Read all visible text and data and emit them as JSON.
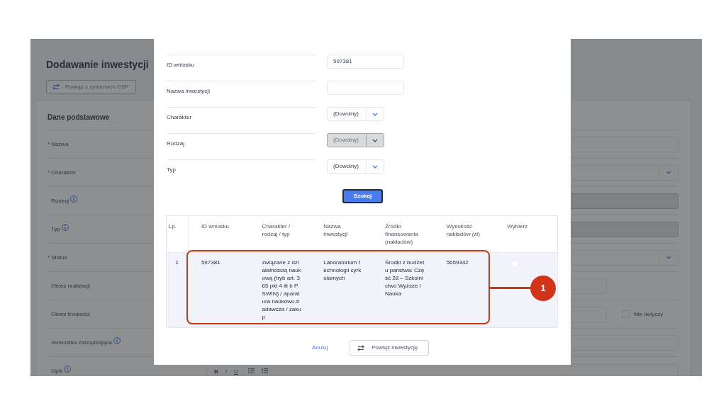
{
  "page": {
    "title": "Dodawanie inwestycji",
    "link_button": "Powiąż z systemem OSF",
    "section_title": "Dane podstawowe",
    "fields": [
      {
        "marker": "*",
        "label": "Nazwa",
        "info": false,
        "kind": "input"
      },
      {
        "marker": "*",
        "label": "Charakter",
        "info": false,
        "kind": "select"
      },
      {
        "label": "Rodzaj",
        "info": true,
        "kind": "disabled"
      },
      {
        "label": "Typ",
        "info": true,
        "kind": "disabled"
      },
      {
        "marker": "*",
        "label": "Status",
        "info": false,
        "kind": "select"
      },
      {
        "label": "Okres realizacji",
        "info": false,
        "kind": "short"
      },
      {
        "label": "Okres trwałości",
        "info": false,
        "kind": "short",
        "checkbox": {
          "label": "Nie dotyczy",
          "checked": false
        }
      },
      {
        "label": "Jednostka zarządzająca",
        "info": true,
        "kind": "input"
      },
      {
        "label": "Opis",
        "info": true,
        "kind": "editor",
        "toolbar": [
          "B",
          "I",
          "U"
        ]
      }
    ]
  },
  "dialog": {
    "filters": [
      {
        "label": "ID wniosku",
        "kind": "input",
        "value": "597381"
      },
      {
        "label": "Nazwa inwestycji",
        "kind": "input"
      },
      {
        "label": "Charakter",
        "kind": "select",
        "value": "(Dowolny)",
        "disabled": false
      },
      {
        "label": "Rodzaj",
        "kind": "select",
        "value": "(Dowolny)",
        "disabled": true
      },
      {
        "label": "Typ",
        "kind": "select",
        "value": "(Dowolny)",
        "disabled": false
      }
    ],
    "search_button": "Szukaj",
    "table": {
      "columns": [
        "Lp.",
        "ID wniosku",
        "Charakter / rodzaj / typ",
        "Nazwa inwestycji",
        "Źródło finansowania (nakładów)",
        "Wysokość nakładów (zł)",
        "Wybierz"
      ],
      "rows": [
        {
          "cells": [
            "1",
            "597381",
            "związane z działalnością naukową (tryb art. 365 pkt 4 lit b PSWIN) / aparatura naukowo-badawcza / zakup",
            "Laboratorium technologii cyrkularnych",
            "Środki z budżetu państwa: Część 28 – Szkolnictwo Wyższe i Nauka",
            "5659342"
          ],
          "selected": false
        }
      ]
    },
    "cancel": "Anuluj",
    "confirm": "Powiąż inwestycję"
  },
  "callout": {
    "number": "1"
  }
}
